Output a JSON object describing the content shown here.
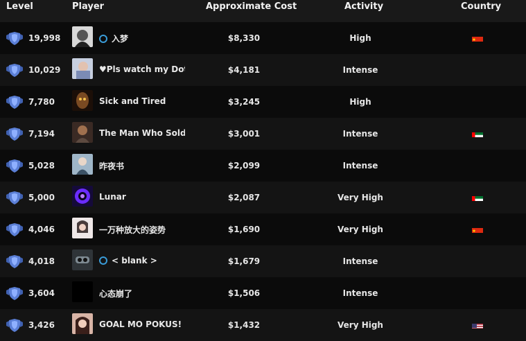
{
  "columns": {
    "level": "Level",
    "player": "Player",
    "cost": "Approximate Cost",
    "activity": "Activity",
    "country": "Country"
  },
  "rows": [
    {
      "level": "19,998",
      "name": "入梦",
      "online": true,
      "cost": "$8,330",
      "activity": "High",
      "country": "cn",
      "avatar_icon": "player-avatar-icon"
    },
    {
      "level": "10,029",
      "name": "♥Pls watch my Dota /",
      "online": false,
      "cost": "$4,181",
      "activity": "Intense",
      "country": "",
      "avatar_icon": "player-avatar-icon"
    },
    {
      "level": "7,780",
      "name": "Sick and Tired",
      "online": false,
      "cost": "$3,245",
      "activity": "High",
      "country": "",
      "avatar_icon": "player-avatar-icon"
    },
    {
      "level": "7,194",
      "name": "The Man Who Sold T",
      "online": false,
      "cost": "$3,001",
      "activity": "Intense",
      "country": "ae",
      "avatar_icon": "player-avatar-icon"
    },
    {
      "level": "5,028",
      "name": "昨夜书",
      "online": false,
      "cost": "$2,099",
      "activity": "Intense",
      "country": "",
      "avatar_icon": "player-avatar-icon"
    },
    {
      "level": "5,000",
      "name": "Lunar",
      "online": false,
      "cost": "$2,087",
      "activity": "Very High",
      "country": "ae",
      "avatar_icon": "player-avatar-icon"
    },
    {
      "level": "4,046",
      "name": "一万种放大的姿势",
      "online": false,
      "cost": "$1,690",
      "activity": "Very High",
      "country": "cn",
      "avatar_icon": "player-avatar-icon"
    },
    {
      "level": "4,018",
      "name": "< blank >",
      "online": true,
      "cost": "$1,679",
      "activity": "Intense",
      "country": "",
      "avatar_icon": "player-avatar-icon"
    },
    {
      "level": "3,604",
      "name": "心态崩了",
      "online": false,
      "cost": "$1,506",
      "activity": "Intense",
      "country": "",
      "avatar_icon": "player-avatar-icon"
    },
    {
      "level": "3,426",
      "name": "GOAL MO POKUS!",
      "online": false,
      "cost": "$1,432",
      "activity": "Very High",
      "country": "us",
      "avatar_icon": "player-avatar-icon"
    }
  ],
  "colors": {
    "background": "#141414",
    "row_alt": "#0b0b0b",
    "header": "#191919",
    "text": "#e6e6e6",
    "online": "#3a9cd8",
    "shield": "#5b7fd6"
  },
  "icons": {
    "level": "shield-level-icon",
    "online": "online-status-icon",
    "flag_cn": "china-flag-icon",
    "flag_ae": "uae-flag-icon",
    "flag_us": "usa-flag-icon"
  }
}
